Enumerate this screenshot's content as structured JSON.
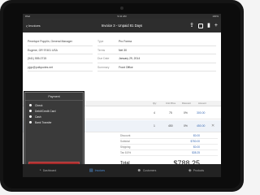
{
  "status_bar": {
    "carrier": "iPad",
    "clock": "9:41 AM",
    "battery": "100%"
  },
  "nav": {
    "back_label": "Invoices",
    "title": "Invoice 3 - Unpaid 81 Days",
    "icons": [
      "share-icon",
      "copy-icon",
      "trash-icon",
      "add-icon"
    ]
  },
  "customer": {
    "lines": [
      "Penelope Popplin, General Manager",
      "Eugene, OR 97401 USA",
      "(541) 555-0715",
      "pjpp@pullquotes.net"
    ]
  },
  "details": [
    {
      "key": "Type",
      "value": "Pro Forma"
    },
    {
      "key": "Terms",
      "value": "Net 30"
    },
    {
      "key": "Due Date",
      "value": "January 29, 2014"
    },
    {
      "key": "Summary",
      "value": "Front Office"
    }
  ],
  "line_items": {
    "headers": {
      "qty": "Qty",
      "unit_price": "Unit Price",
      "discount": "Discount",
      "amount": "Amount"
    },
    "rows": [
      {
        "qty": "4",
        "unit_price": "75",
        "discount": "0%",
        "amount": "300.00"
      },
      {
        "qty": "1",
        "unit_price": "450",
        "discount": "0%",
        "amount": "450.00"
      }
    ]
  },
  "totals": {
    "rows": [
      {
        "label": "Discount",
        "value": "$0.00"
      },
      {
        "label": "Subtotal",
        "value": "$750.00"
      },
      {
        "label": "Shipping",
        "value": "$0.00"
      },
      {
        "label": "Tax  8.5%",
        "value": "$38.25"
      }
    ],
    "total_label": "Total",
    "total_value": "$788.25"
  },
  "payment_popover": {
    "title": "Payment",
    "options": [
      "Check",
      "Debit/Credit Card",
      "Cash",
      "Bank Transfer"
    ],
    "button_label": "Set Payment Status",
    "button_warning": "!",
    "button_caret": "▶"
  },
  "tabs": [
    {
      "label": "Dashboard",
      "icon": "dashboard-icon",
      "glyph": "◔",
      "active": false
    },
    {
      "label": "Invoices",
      "icon": "invoices-icon",
      "glyph": "▤",
      "active": true
    },
    {
      "label": "Customers",
      "icon": "customers-icon",
      "glyph": "☻",
      "active": false
    },
    {
      "label": "Products",
      "icon": "products-icon",
      "glyph": "◈",
      "active": false
    }
  ],
  "colors": {
    "accent": "#4f8fd6",
    "alert": "#a52a2a",
    "chrome": "#2d2d2d"
  }
}
